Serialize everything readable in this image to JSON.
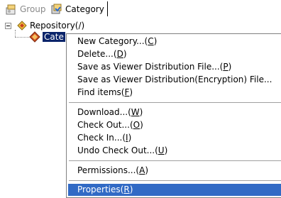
{
  "tabs": [
    {
      "label": "Group",
      "icon": "group-icon",
      "active": false
    },
    {
      "label": "Category",
      "icon": "category-icon",
      "active": true
    }
  ],
  "tree": {
    "root": {
      "label": "Repository(/)",
      "icon": "repository-icon",
      "expanded": true
    },
    "selected_child": {
      "label": "Category",
      "visible_label": "Cate",
      "icon": "category-icon"
    }
  },
  "context_menu": {
    "items": [
      {
        "text": "New Category...",
        "key": "C"
      },
      {
        "text": "Delete...",
        "key": "D"
      },
      {
        "text": "Save as Viewer Distribution File...",
        "key": "P"
      },
      {
        "text": "Save as Viewer Distribution(Encryption) File...",
        "key": ""
      },
      {
        "text": "Find items",
        "key": "F"
      },
      {
        "text": "Download...",
        "key": "W"
      },
      {
        "text": "Check Out...",
        "key": "O"
      },
      {
        "text": "Check In...",
        "key": "I"
      },
      {
        "text": "Undo Check Out...",
        "key": "U"
      },
      {
        "text": "Permissions...",
        "key": "A"
      },
      {
        "text": "Properties",
        "key": "R"
      }
    ],
    "highlighted_item": "Properties"
  },
  "colors": {
    "selection": "#0a246a",
    "menu_highlight": "#316ac5"
  }
}
